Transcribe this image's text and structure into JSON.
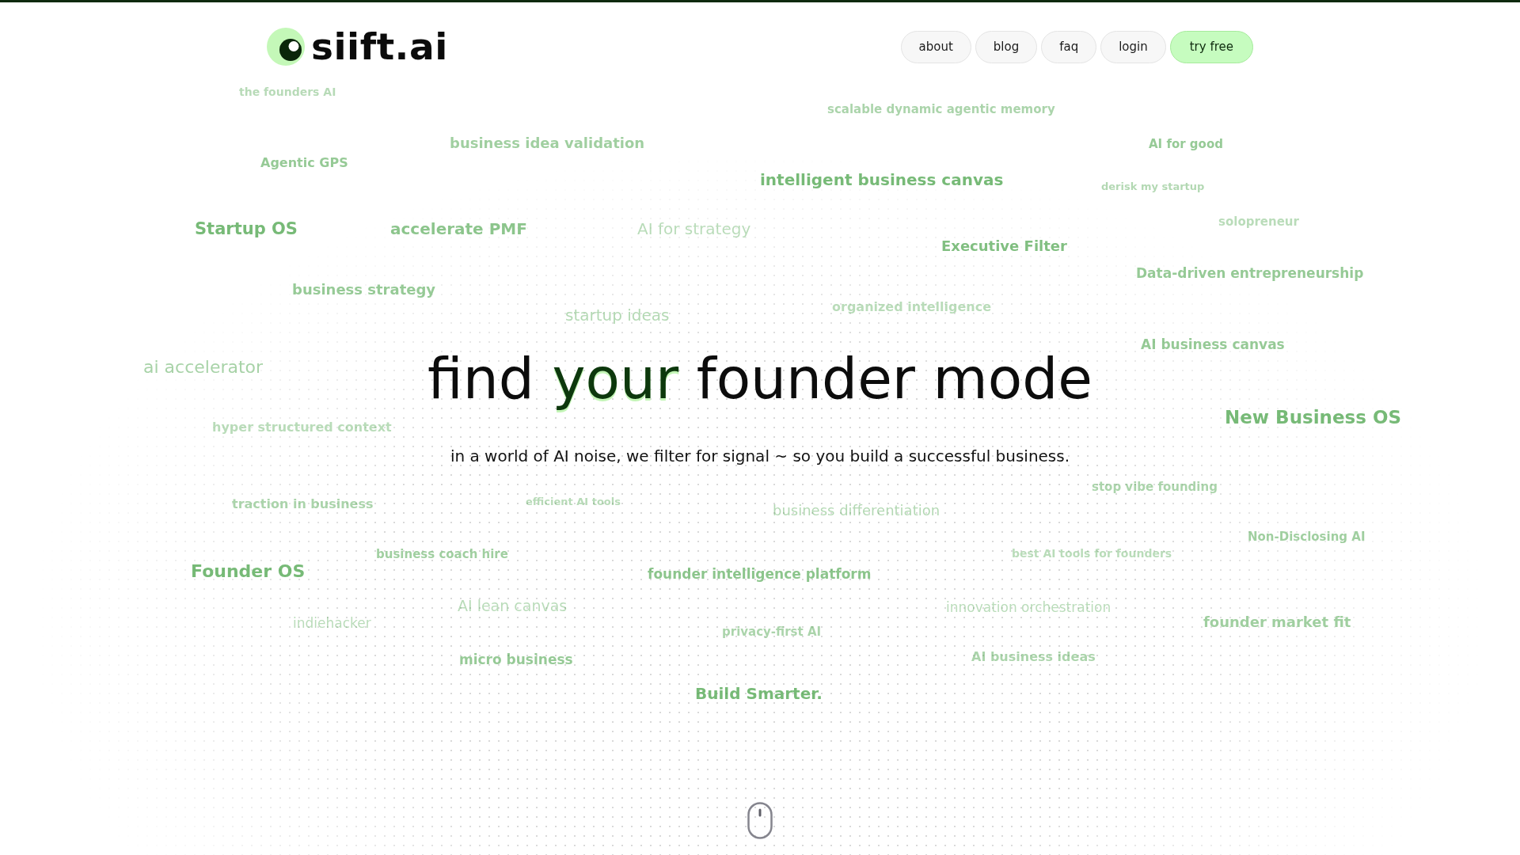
{
  "header": {
    "logo": {
      "text": "siift.ai"
    },
    "nav": [
      {
        "label": "about",
        "kind": "plain"
      },
      {
        "label": "blog",
        "kind": "plain"
      },
      {
        "label": "faq",
        "kind": "plain"
      },
      {
        "label": "login",
        "kind": "plain"
      },
      {
        "label": "try free",
        "kind": "primary"
      }
    ]
  },
  "keyword_cloud": [
    "the founders AI",
    "scalable dynamic agentic memory",
    "business idea validation",
    "AI for good",
    "Agentic GPS",
    "intelligent business canvas",
    "derisk my startup",
    "solopreneur",
    "Startup OS",
    "accelerate PMF",
    "AI for strategy",
    "Executive Filter",
    "Data-driven entrepreneurship",
    "business strategy",
    "organized intelligence",
    "startup ideas",
    "AI business canvas",
    "ai accelerator",
    "New Business OS",
    "hyper structured context",
    "stop vibe founding",
    "traction in business",
    "efficient AI tools",
    "business differentiation",
    "Non-Disclosing AI",
    "business coach hire",
    "best AI tools for founders",
    "Founder OS",
    "founder intelligence platform",
    "AI lean canvas",
    "innovation orchestration",
    "indiehacker",
    "founder market fit",
    "privacy-first AI",
    "micro business",
    "AI business ideas",
    "Build Smarter."
  ],
  "hero": {
    "heading": [
      {
        "text": "find",
        "highlighted": false
      },
      {
        "text": "your",
        "highlighted": true
      },
      {
        "text": "founder mode",
        "highlighted": false
      }
    ],
    "subtitle": "in a world of AI noise, we filter for signal ~ so you build a successful business."
  }
}
